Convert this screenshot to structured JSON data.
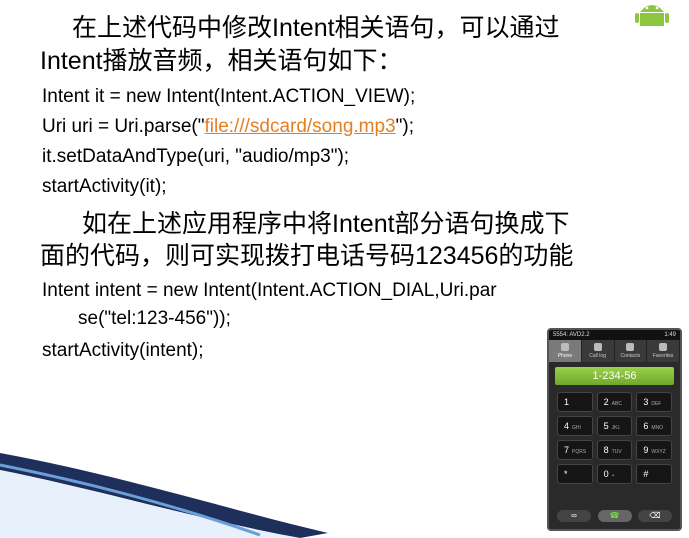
{
  "paragraphs": [
    "在上述代码中修改Intent相关语句，可以通过",
    "Intent播放音频，相关语句如下：",
    "如在上述应用程序中将Intent部分语句换成下",
    "面的代码，则可实现拨打电话号码123456的功能"
  ],
  "code1": {
    "line1": "Intent it = new Intent(Intent.ACTION_VIEW);",
    "line2_pre": "Uri uri = Uri.parse(\"",
    "line2_link": "file:///sdcard/song.mp3",
    "line2_post": "\");",
    "line3": "it.setDataAndType(uri, \"audio/mp3\");",
    "line4": "startActivity(it);"
  },
  "code2": {
    "line1": "Intent intent = new Intent(Intent.ACTION_DIAL,Uri.par",
    "line2": "se(\"tel:123-456\"));",
    "line3": "startActivity(intent);"
  },
  "phone": {
    "status_left": "5554: AVD2.2",
    "status_time": "1:49",
    "tabs": [
      "Phone",
      "Call log",
      "Contacts",
      "Favorites"
    ],
    "number": "1-234-56",
    "keys": [
      {
        "d": "1",
        "l": ""
      },
      {
        "d": "2",
        "l": "ABC"
      },
      {
        "d": "3",
        "l": "DEF"
      },
      {
        "d": "4",
        "l": "GHI"
      },
      {
        "d": "5",
        "l": "JKL"
      },
      {
        "d": "6",
        "l": "MNO"
      },
      {
        "d": "7",
        "l": "PQRS"
      },
      {
        "d": "8",
        "l": "TUV"
      },
      {
        "d": "9",
        "l": "WXYZ"
      },
      {
        "d": "*",
        "l": ""
      },
      {
        "d": "0",
        "l": "+"
      },
      {
        "d": "#",
        "l": ""
      }
    ]
  },
  "colors": {
    "link": "#e67e22",
    "swoosh_dark": "#1f2f5c",
    "swoosh_light": "#6a9fd8",
    "android": "#8cc63f"
  }
}
